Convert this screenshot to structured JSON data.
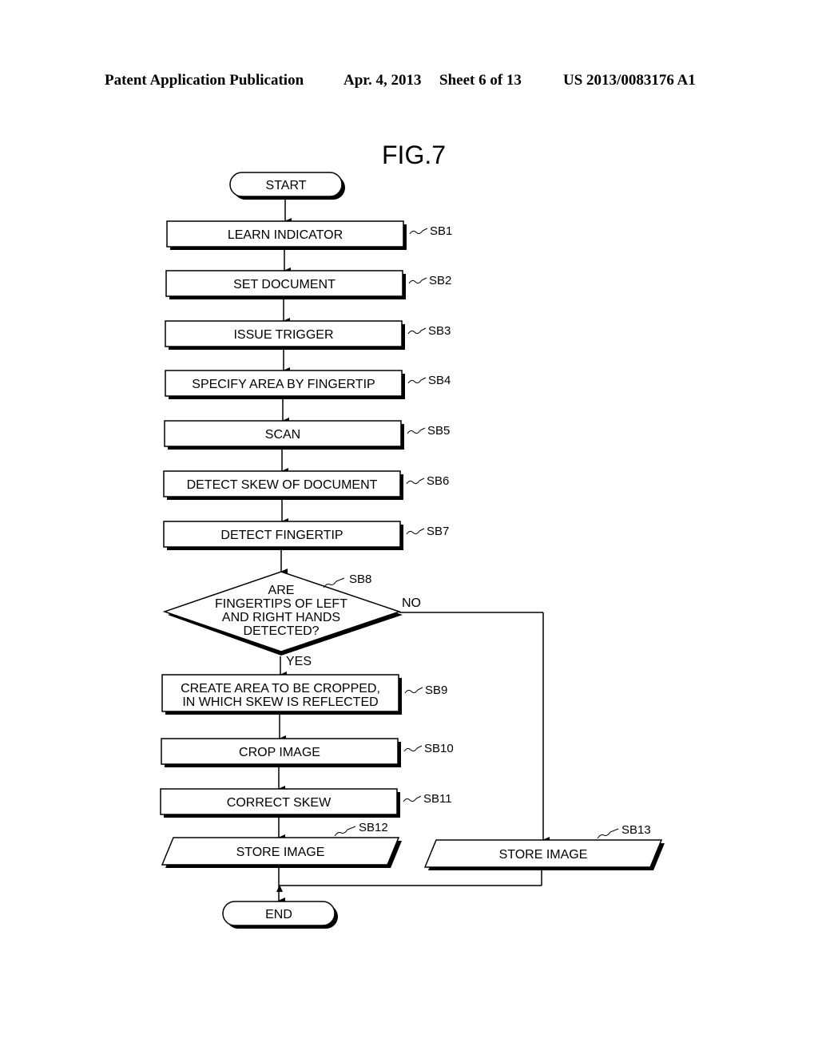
{
  "header": {
    "publication": "Patent Application Publication",
    "date": "Apr. 4, 2013",
    "sheet": "Sheet 6 of 13",
    "number": "US 2013/0083176 A1"
  },
  "figure": {
    "title": "FIG.7",
    "start": "START",
    "end": "END",
    "steps": [
      {
        "id": "SB1",
        "text": "LEARN INDICATOR"
      },
      {
        "id": "SB2",
        "text": "SET DOCUMENT"
      },
      {
        "id": "SB3",
        "text": "ISSUE TRIGGER"
      },
      {
        "id": "SB4",
        "text": "SPECIFY AREA BY FINGERTIP"
      },
      {
        "id": "SB5",
        "text": "SCAN"
      },
      {
        "id": "SB6",
        "text": "DETECT SKEW OF DOCUMENT"
      },
      {
        "id": "SB7",
        "text": "DETECT FINGERTIP"
      }
    ],
    "decision": {
      "id": "SB8",
      "lines": [
        "ARE",
        "FINGERTIPS OF LEFT",
        "AND RIGHT HANDS",
        "DETECTED?"
      ],
      "yes": "YES",
      "no": "NO"
    },
    "yes_steps": [
      {
        "id": "SB9",
        "lines": [
          "CREATE AREA TO BE CROPPED,",
          "IN WHICH SKEW IS REFLECTED"
        ]
      },
      {
        "id": "SB10",
        "lines": [
          "CROP IMAGE"
        ]
      },
      {
        "id": "SB11",
        "lines": [
          "CORRECT SKEW"
        ]
      }
    ],
    "store_yes": {
      "id": "SB12",
      "text": "STORE IMAGE"
    },
    "store_no": {
      "id": "SB13",
      "text": "STORE IMAGE"
    }
  }
}
